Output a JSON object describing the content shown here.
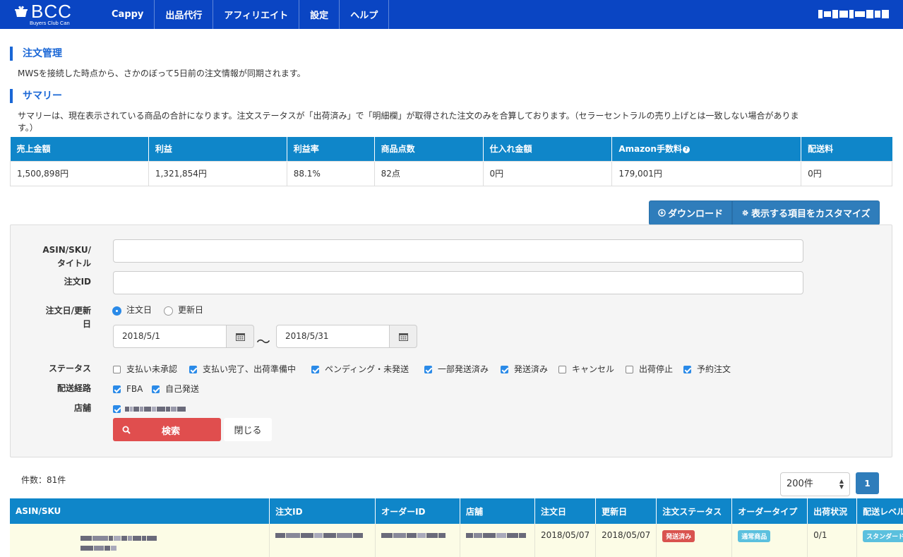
{
  "app": {
    "brand_name": "BCC",
    "brand_sub": "Buyers Club Can",
    "nav": [
      "Cappy",
      "出品代行",
      "アフィリエイト",
      "設定",
      "ヘルプ"
    ]
  },
  "orders_section": {
    "title": "注文管理",
    "description": "MWSを接続した時点から、さかのぼって5日前の注文情報が同期されます。"
  },
  "summary_section": {
    "title": "サマリー",
    "description": "サマリーは、現在表示されている商品の合計になります。注文ステータスが「出荷済み」で「明細欄」が取得された注文のみを合算しております。（セラーセントラルの売り上げとは一致しない場合がありま",
    "description_cont": "す。）",
    "headers": [
      "売上金額",
      "利益",
      "利益率",
      "商品点数",
      "仕入れ金額",
      "Amazon手数料",
      "配送料"
    ],
    "values": [
      "1,500,898円",
      "1,321,854円",
      "88.1%",
      "82点",
      "0円",
      "179,001円",
      "0円"
    ]
  },
  "actions": {
    "download": "ダウンロード",
    "customize": "表示する項目をカスタマイズ"
  },
  "filters": {
    "asin_label_1": "ASIN/SKU/",
    "asin_label_2": "タイトル",
    "asin_value": "",
    "order_id_label": "注文ID",
    "order_id_value": "",
    "date_label_1": "注文日/更新",
    "date_label_2": "日",
    "date_type_options": [
      {
        "label": "注文日",
        "selected": true
      },
      {
        "label": "更新日",
        "selected": false
      }
    ],
    "date_from": "2018/5/1",
    "date_sep": "〜",
    "date_to": "2018/5/31",
    "status_label": "ステータス",
    "statuses": [
      {
        "label": "支払い未承認",
        "checked": false
      },
      {
        "label": "支払い完了、出荷準備中",
        "checked": true
      },
      {
        "label": "ペンディング・未発送",
        "checked": true
      },
      {
        "label": "一部発送済み",
        "checked": true
      },
      {
        "label": "発送済み",
        "checked": true
      },
      {
        "label": "キャンセル",
        "checked": false
      },
      {
        "label": "出荷停止",
        "checked": false
      },
      {
        "label": "予約注文",
        "checked": true
      }
    ],
    "shipping_label": "配送経路",
    "shipping": [
      {
        "label": "FBA",
        "checked": true
      },
      {
        "label": "自己発送",
        "checked": true
      }
    ],
    "store_label": "店舗",
    "store_checked": true,
    "search_button": "検索",
    "close_button": "閉じる"
  },
  "results": {
    "count_text": "件数：81件",
    "per_page": "200件",
    "page": "1",
    "headers": [
      "ASIN/SKU",
      "注文ID",
      "オーダーID",
      "店舗",
      "注文日",
      "更新日",
      "注文ステータス",
      "オーダータイプ",
      "出荷状況",
      "配送レベル"
    ],
    "row": {
      "order_date": "2018/05/07",
      "updated_date": "2018/05/07",
      "status": "発送済み",
      "order_type": "通常商品",
      "shipment": "0/1",
      "ship_level": "スタンダード"
    }
  },
  "colors": {
    "nav_bg": "#0a45c3",
    "accent": "#1a67d6",
    "table_header": "#0f86c9",
    "button_blue": "#2f7dbb",
    "search_red": "#e04e4e",
    "badge_red": "#d9534f",
    "badge_cyan": "#5bc0de",
    "row_highlight": "#fcfce6"
  }
}
